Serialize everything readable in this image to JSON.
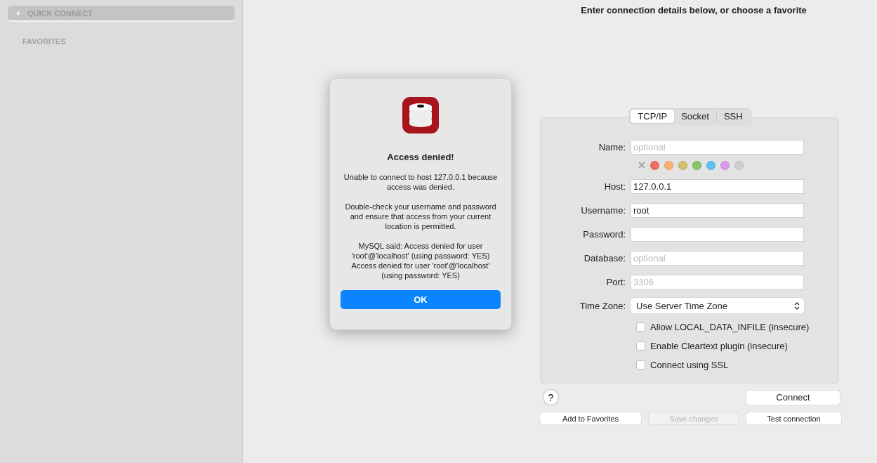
{
  "sidebar": {
    "items": [
      {
        "label": "QUICK CONNECT",
        "selected": true
      }
    ],
    "section_header": "FAVORITES"
  },
  "heading": "Enter connection details below, or choose a favorite",
  "tabs": [
    {
      "label": "TCP/IP",
      "selected": true
    },
    {
      "label": "Socket",
      "selected": false
    },
    {
      "label": "SSH",
      "selected": false
    }
  ],
  "fields_top": [
    {
      "label": "Name:",
      "placeholder": "optional"
    }
  ],
  "colors": [
    {
      "color": "#f26b5e"
    },
    {
      "color": "#f9b26b"
    },
    {
      "color": "#d4bf6a"
    },
    {
      "color": "#88c666"
    },
    {
      "color": "#5ec1f4"
    },
    {
      "color": "#d99cec"
    },
    {
      "color": "#d0d0d0"
    }
  ],
  "fields": [
    {
      "label": "Host:",
      "value": "127.0.0.1"
    },
    {
      "label": "Username:",
      "value": "root"
    },
    {
      "label": "Password:"
    },
    {
      "label": "Database:",
      "placeholder": "optional"
    },
    {
      "label": "Port:",
      "placeholder": "3306"
    }
  ],
  "time_zone": {
    "label": "Time Zone:",
    "value": "Use Server Time Zone"
  },
  "checkboxes": [
    {
      "label": "Allow LOCAL_DATA_INFILE (insecure)",
      "checked": false
    },
    {
      "label": "Enable Cleartext plugin (insecure)",
      "checked": false
    },
    {
      "label": "Connect using SSL",
      "checked": false
    }
  ],
  "help": "?",
  "connect_button": "Connect",
  "buttons": [
    {
      "label": "Add to Favorites",
      "disabled": false
    },
    {
      "label": "Save changes",
      "disabled": true
    },
    {
      "label": "Test connection",
      "disabled": false
    }
  ],
  "dialog": {
    "title": "Access denied!",
    "paragraphs": [
      "Unable to connect to host 127.0.0.1 because access was denied.",
      "Double-check your username and password and ensure that access from your current location is permitted.",
      "MySQL said: Access denied for user 'root'@'localhost' (using password: YES) Access denied for user 'root'@'localhost' (using password: YES)"
    ],
    "button": "OK"
  }
}
